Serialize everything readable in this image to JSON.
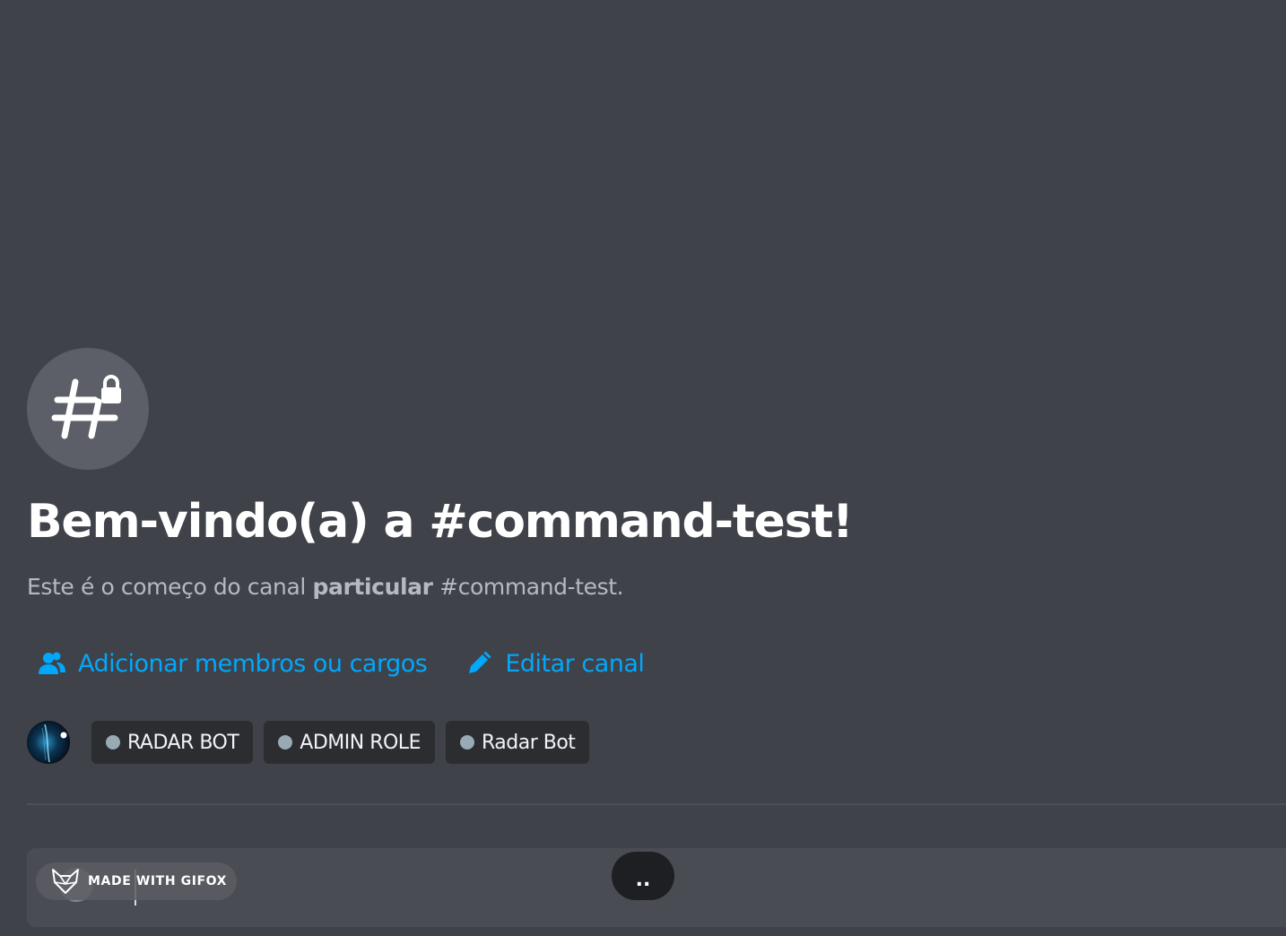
{
  "channel": {
    "icon": "private-channel-hash-lock-icon",
    "welcome_title": "Bem-vindo(a) a #command-test!",
    "subtitle_prefix": "Este é o começo do canal ",
    "subtitle_bold": "particular",
    "subtitle_suffix": " #command-test."
  },
  "actions": [
    {
      "icon": "members-icon",
      "label": "Adicionar membros ou cargos"
    },
    {
      "icon": "pencil-icon",
      "label": "Editar canal"
    }
  ],
  "members": {
    "avatar": "user-avatar",
    "roles": [
      {
        "label": "RADAR BOT",
        "color": "#99aab5"
      },
      {
        "label": "ADMIN ROLE",
        "color": "#99aab5"
      },
      {
        "label": "Radar Bot",
        "color": "#99aab5"
      }
    ]
  },
  "watermark": {
    "icon": "gifox-logo-icon",
    "label": "MADE WITH GIFOX"
  },
  "typing_indicator": {
    "text": ".."
  },
  "colors": {
    "background": "#404249",
    "link": "#00a8fc",
    "pill_background": "#2b2d31",
    "composer_background": "#4a4c54"
  }
}
